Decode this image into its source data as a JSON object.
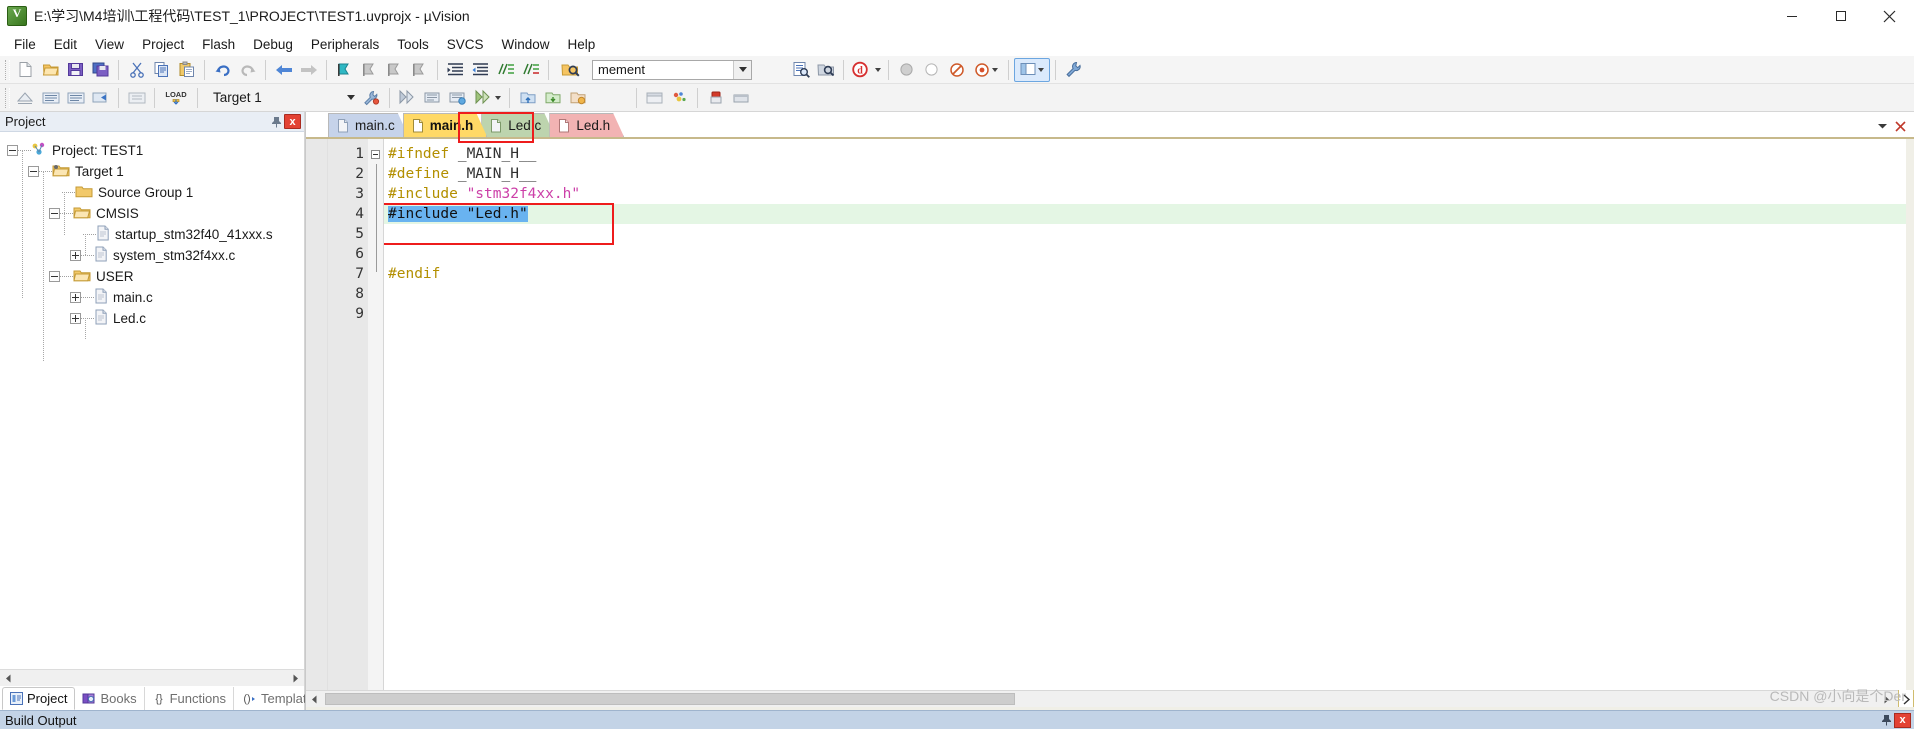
{
  "window": {
    "title": "E:\\学习\\M4培训\\工程代码\\TEST_1\\PROJECT\\TEST1.uvprojx - µVision",
    "app_icon": "uvision-icon",
    "minimize_label": "Minimize",
    "maximize_label": "Maximize",
    "close_label": "Close"
  },
  "menubar": {
    "items": [
      {
        "label": "File"
      },
      {
        "label": "Edit"
      },
      {
        "label": "View"
      },
      {
        "label": "Project"
      },
      {
        "label": "Flash"
      },
      {
        "label": "Debug"
      },
      {
        "label": "Peripherals"
      },
      {
        "label": "Tools"
      },
      {
        "label": "SVCS"
      },
      {
        "label": "Window"
      },
      {
        "label": "Help"
      }
    ]
  },
  "toolbar_main": {
    "search_value": "mement",
    "search_placeholder": "",
    "buttons": [
      {
        "name": "new-file",
        "tip": "New"
      },
      {
        "name": "open-file",
        "tip": "Open"
      },
      {
        "name": "save-file",
        "tip": "Save"
      },
      {
        "name": "save-all",
        "tip": "Save All"
      },
      {
        "name": "cut",
        "tip": "Cut"
      },
      {
        "name": "copy",
        "tip": "Copy"
      },
      {
        "name": "paste",
        "tip": "Paste"
      },
      {
        "name": "undo",
        "tip": "Undo"
      },
      {
        "name": "redo",
        "tip": "Redo"
      },
      {
        "name": "navigate-backward",
        "tip": "Back"
      },
      {
        "name": "navigate-forward",
        "tip": "Forward"
      },
      {
        "name": "bookmark-toggle",
        "tip": "Insert/Remove Bookmark"
      },
      {
        "name": "bookmark-prev",
        "tip": "Previous Bookmark"
      },
      {
        "name": "bookmark-next",
        "tip": "Next Bookmark"
      },
      {
        "name": "bookmark-clear",
        "tip": "Clear All Bookmarks"
      },
      {
        "name": "indent-right",
        "tip": "Indent"
      },
      {
        "name": "indent-left",
        "tip": "Outdent"
      },
      {
        "name": "comment-lines",
        "tip": "Comment"
      },
      {
        "name": "uncomment-lines",
        "tip": "Uncomment"
      },
      {
        "name": "find-in-files",
        "tip": "Find in Files"
      },
      {
        "name": "incremental-find",
        "tip": "Incremental Find"
      },
      {
        "name": "browse-symbol",
        "tip": "Browse Symbol"
      },
      {
        "name": "find-reference",
        "tip": "Find References"
      },
      {
        "name": "debug-start",
        "tip": "Start/Stop Debug Session"
      },
      {
        "name": "breakpoint-insert",
        "tip": "Insert/Remove Breakpoint"
      },
      {
        "name": "breakpoint-disable",
        "tip": "Disable Breakpoint"
      },
      {
        "name": "breakpoint-kill-all",
        "tip": "Kill All Breakpoints"
      },
      {
        "name": "configure-view",
        "tip": "Configure"
      },
      {
        "name": "window-layout",
        "tip": "Window Layout"
      },
      {
        "name": "configure-tools",
        "tip": "Configure Tools"
      }
    ]
  },
  "toolbar_build": {
    "target_value": "Target 1",
    "load_label": "LOAD",
    "buttons": [
      {
        "name": "translate-file",
        "tip": "Translate"
      },
      {
        "name": "build-target",
        "tip": "Build"
      },
      {
        "name": "rebuild-all",
        "tip": "Rebuild All"
      },
      {
        "name": "batch-build",
        "tip": "Batch Build"
      },
      {
        "name": "stop-build",
        "tip": "Stop Build"
      },
      {
        "name": "download-to-flash",
        "tip": "Download"
      },
      {
        "name": "target-options",
        "tip": "Options for Target"
      },
      {
        "name": "manage-run-time",
        "tip": "Manage Run-Time Environment"
      },
      {
        "name": "pack-installer",
        "tip": "Pack Installer"
      },
      {
        "name": "svcs-commit",
        "tip": "Commit"
      },
      {
        "name": "svcs-update",
        "tip": "Update"
      }
    ]
  },
  "project_panel": {
    "header_title": "Project",
    "pin_label": "Auto Hide",
    "close_label": "x",
    "tree": [
      {
        "level": 0,
        "label": "Project: TEST1",
        "icon": "project-icon",
        "expander": "minus"
      },
      {
        "level": 1,
        "label": "Target 1",
        "icon": "target-icon",
        "expander": "minus"
      },
      {
        "level": 2,
        "label": "Source Group 1",
        "icon": "folder-icon",
        "expander": "none"
      },
      {
        "level": 2,
        "label": "CMSIS",
        "icon": "folder-open-icon",
        "expander": "minus"
      },
      {
        "level": 3,
        "label": "startup_stm32f40_41xxx.s",
        "icon": "file-icon",
        "expander": "none"
      },
      {
        "level": 3,
        "label": "system_stm32f4xx.c",
        "icon": "file-icon",
        "expander": "plus"
      },
      {
        "level": 2,
        "label": "USER",
        "icon": "folder-open-icon",
        "expander": "minus"
      },
      {
        "level": 3,
        "label": "main.c",
        "icon": "file-icon",
        "expander": "plus"
      },
      {
        "level": 3,
        "label": "Led.c",
        "icon": "file-icon",
        "expander": "plus"
      }
    ],
    "bottom_tabs": [
      {
        "label": "Project",
        "icon": "project-tab-icon",
        "active": true
      },
      {
        "label": "Books",
        "icon": "books-tab-icon",
        "active": false
      },
      {
        "label": "Functions",
        "icon": "functions-tab-icon",
        "active": false
      },
      {
        "label": "Templates",
        "icon": "templates-tab-icon",
        "active": false
      }
    ]
  },
  "editor": {
    "tabs": [
      {
        "label": "main.c",
        "color": "#c6d3ea",
        "active": false,
        "highlighted": false
      },
      {
        "label": "main.h",
        "color": "#ffd966",
        "active": true,
        "highlighted": true
      },
      {
        "label": "Led.c",
        "color": "#bdd4ae",
        "active": false,
        "highlighted": false
      },
      {
        "label": "Led.h",
        "color": "#f2b3b3",
        "active": false,
        "highlighted": false
      }
    ],
    "collapse_label": "▾",
    "close_label": "✕",
    "line_numbers": [
      "1",
      "2",
      "3",
      "4",
      "5",
      "6",
      "7",
      "8",
      "9"
    ],
    "lines": [
      {
        "n": 1,
        "tokens": [
          {
            "t": "#ifndef ",
            "c": "pp"
          },
          {
            "t": "_MAIN_H__",
            "c": "id"
          }
        ],
        "fold": "start",
        "current": false,
        "selected": false
      },
      {
        "n": 2,
        "tokens": [
          {
            "t": "#define ",
            "c": "pp"
          },
          {
            "t": "_MAIN_H__",
            "c": "id"
          }
        ],
        "fold": "bar",
        "current": false,
        "selected": false
      },
      {
        "n": 3,
        "tokens": [
          {
            "t": "#include ",
            "c": "pp"
          },
          {
            "t": "\"stm32f4xx.h\"",
            "c": "str"
          }
        ],
        "fold": "bar",
        "current": false,
        "selected": false
      },
      {
        "n": 4,
        "tokens": [
          {
            "t": "#include \"Led.h\"",
            "c": "sel"
          }
        ],
        "fold": "bar",
        "current": true,
        "selected": true
      },
      {
        "n": 5,
        "tokens": [],
        "fold": "bar",
        "current": false,
        "selected": false
      },
      {
        "n": 6,
        "tokens": [],
        "fold": "bar",
        "current": false,
        "selected": false
      },
      {
        "n": 7,
        "tokens": [
          {
            "t": "#endif",
            "c": "pp"
          }
        ],
        "fold": "end",
        "current": false,
        "selected": false
      },
      {
        "n": 8,
        "tokens": [],
        "fold": "none",
        "current": false,
        "selected": false
      },
      {
        "n": 9,
        "tokens": [],
        "fold": "none",
        "current": false,
        "selected": false
      }
    ]
  },
  "build_output": {
    "title": "Build Output",
    "pin_label": "Auto Hide",
    "close_label": "x"
  },
  "watermark": {
    "text": "CSDN @小向是个Der"
  },
  "colors": {
    "accent_highlight": "#ee1c1c",
    "tab_active": "#ffd966",
    "selection": "#69b3f0",
    "current_line": "#e4f6e4",
    "preprocessor": "#b38f00",
    "string": "#cc3fa8",
    "panel_header": "#e9eef5",
    "build_bar": "#c3d3e6"
  }
}
